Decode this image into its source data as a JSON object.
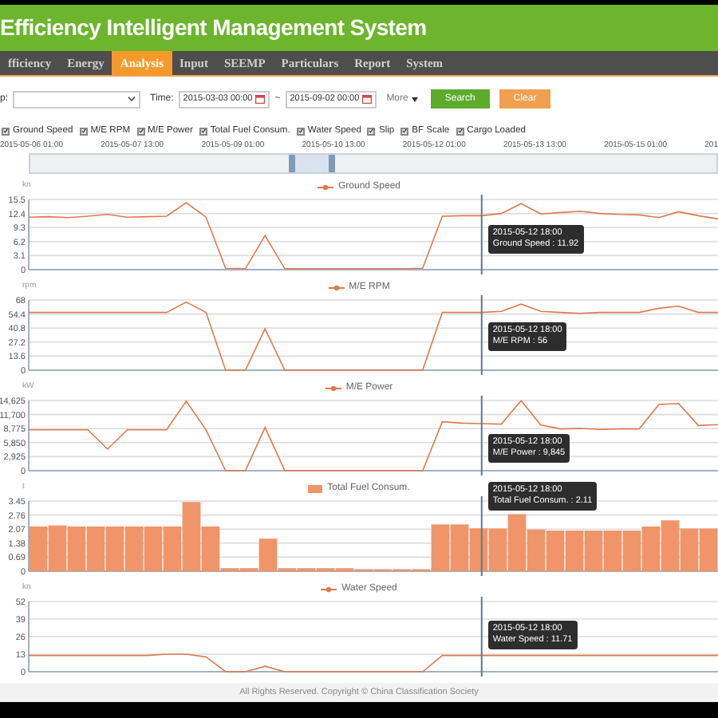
{
  "header": {
    "title": "Efficiency Intelligent Management System"
  },
  "nav": [
    {
      "label": "fficiency",
      "selected": false
    },
    {
      "label": "Energy",
      "selected": false
    },
    {
      "label": "Analysis",
      "selected": true
    },
    {
      "label": "Input",
      "selected": false
    },
    {
      "label": "SEEMP",
      "selected": false
    },
    {
      "label": "Particulars",
      "selected": false
    },
    {
      "label": "Report",
      "selected": false
    },
    {
      "label": "System",
      "selected": false
    }
  ],
  "filter": {
    "ship_label": "p:",
    "time_label": "Time:",
    "start": "2015-03-03 00:00",
    "separator": "~",
    "end": "2015-09-02 00:00",
    "more": "More",
    "search": "Search",
    "clear": "Clear"
  },
  "series_toggles": [
    {
      "label": "Ground Speed",
      "checked": true
    },
    {
      "label": "M/E RPM",
      "checked": true
    },
    {
      "label": "M/E Power",
      "checked": true
    },
    {
      "label": "Total Fuel Consum.",
      "checked": true
    },
    {
      "label": "Water Speed",
      "checked": true
    },
    {
      "label": "Slip",
      "checked": true
    },
    {
      "label": "BF Scale",
      "checked": true
    },
    {
      "label": "Cargo Loaded",
      "checked": true
    }
  ],
  "navigator": {
    "dates": [
      "2015-05-06 01:00",
      "2015-05-07 13:00",
      "2015-05-09 01:00",
      "2015-05-10 13:00",
      "2015-05-12 01:00",
      "2015-05-13 13:00",
      "2015-05-15 01:00",
      "201"
    ]
  },
  "charts": [
    {
      "unit": "kn",
      "tooltip": {
        "time": "2015-05-12 18:00",
        "text": "Ground Speed : 11.92"
      },
      "chart_data": {
        "type": "line",
        "ylim": [
          0,
          15.5
        ],
        "yticks": [
          0,
          3.1,
          6.2,
          9.3,
          12.4,
          15.5
        ],
        "grid": true,
        "series": [
          {
            "name": "Ground Speed",
            "color": "#e07a4f",
            "values": [
              11.6,
              11.7,
              11.5,
              11.8,
              12.2,
              11.6,
              11.7,
              11.8,
              14.8,
              11.6,
              0.3,
              0.2,
              7.5,
              0.2,
              0.2,
              0.2,
              0.2,
              0.2,
              0.2,
              0.2,
              0.3,
              11.8,
              11.9,
              11.9,
              12.4,
              14.6,
              12.3,
              12.6,
              12.9,
              12.4,
              12.2,
              12.1,
              11.5,
              12.8,
              11.9,
              11.2
            ]
          }
        ]
      }
    },
    {
      "unit": "rpm",
      "tooltip": {
        "time": "2015-05-12 18:00",
        "text": "M/E RPM : 56"
      },
      "chart_data": {
        "type": "line",
        "ylim": [
          0,
          68
        ],
        "yticks": [
          0,
          13.6,
          27.2,
          40.8,
          54.4,
          68
        ],
        "grid": true,
        "series": [
          {
            "name": "M/E RPM",
            "color": "#e07a4f",
            "values": [
              56,
              56,
              56,
              56,
              56,
              56,
              56,
              56,
              66,
              56,
              0,
              0,
              40,
              0,
              0,
              0,
              0,
              0,
              0,
              0,
              0,
              56,
              56,
              56,
              57,
              64,
              57,
              56,
              55,
              56,
              56,
              56,
              60,
              62,
              56,
              56
            ]
          }
        ]
      }
    },
    {
      "unit": "kW",
      "tooltip": {
        "time": "2015-05-12 18:00",
        "text": "M/E Power : 9,845"
      },
      "chart_data": {
        "type": "line",
        "ylim": [
          0,
          14625
        ],
        "yticks": [
          {
            "value": 0,
            "label": "0"
          },
          {
            "value": 2925,
            "label": "2,925"
          },
          {
            "value": 5850,
            "label": "5,850"
          },
          {
            "value": 8775,
            "label": "8,775"
          },
          {
            "value": 11700,
            "label": "11,700"
          },
          {
            "value": 14625,
            "label": "14,625"
          }
        ],
        "grid": true,
        "series": [
          {
            "name": "M/E Power",
            "color": "#e07a4f",
            "values": [
              8500,
              8500,
              8500,
              8500,
              4500,
              8500,
              8500,
              8500,
              14500,
              8500,
              0,
              0,
              9000,
              0,
              0,
              0,
              0,
              0,
              0,
              0,
              0,
              10200,
              9900,
              9800,
              9700,
              14600,
              9500,
              8700,
              8800,
              8600,
              8700,
              8700,
              13800,
              14000,
              9400,
              9600
            ]
          }
        ]
      }
    },
    {
      "unit": "t",
      "tooltip": {
        "time": "2015-05-12 18:00",
        "text": "Total Fuel Consum. : 2.11"
      },
      "chart_data": {
        "type": "bar",
        "ylim": [
          0,
          3.45
        ],
        "yticks": [
          0,
          0.69,
          1.38,
          2.07,
          2.76,
          3.45
        ],
        "grid": true,
        "series": [
          {
            "name": "Total Fuel Consum.",
            "color": "#f0956a",
            "values": [
              2.2,
              2.25,
              2.2,
              2.2,
              2.2,
              2.2,
              2.2,
              2.2,
              3.4,
              2.2,
              0.15,
              0.15,
              1.6,
              0.15,
              0.15,
              0.15,
              0.15,
              0.1,
              0.1,
              0.1,
              0.1,
              2.3,
              2.3,
              2.11,
              2.1,
              2.8,
              2.05,
              2.0,
              2.0,
              2.0,
              2.0,
              2.0,
              2.2,
              2.5,
              2.1,
              2.1
            ]
          }
        ]
      }
    },
    {
      "unit": "kn",
      "tooltip": {
        "time": "2015-05-12 18:00",
        "text": "Water Speed : 11.71"
      },
      "chart_data": {
        "type": "line",
        "ylim": [
          0,
          52
        ],
        "yticks": [
          0,
          13,
          26,
          39,
          52
        ],
        "grid": true,
        "series": [
          {
            "name": "Water Speed",
            "color": "#e07a4f",
            "values": [
              12,
              12,
              12,
              12,
              12,
              12,
              12,
              13,
              13,
              11,
              0,
              0,
              4,
              0,
              0,
              0,
              0,
              0,
              0,
              0,
              0,
              12,
              12,
              12,
              12,
              12,
              12,
              12,
              12,
              12,
              12,
              12,
              12,
              12,
              12,
              12
            ]
          }
        ]
      }
    }
  ],
  "footer": "All Rights Reserved. Copyright © China Classification Society"
}
